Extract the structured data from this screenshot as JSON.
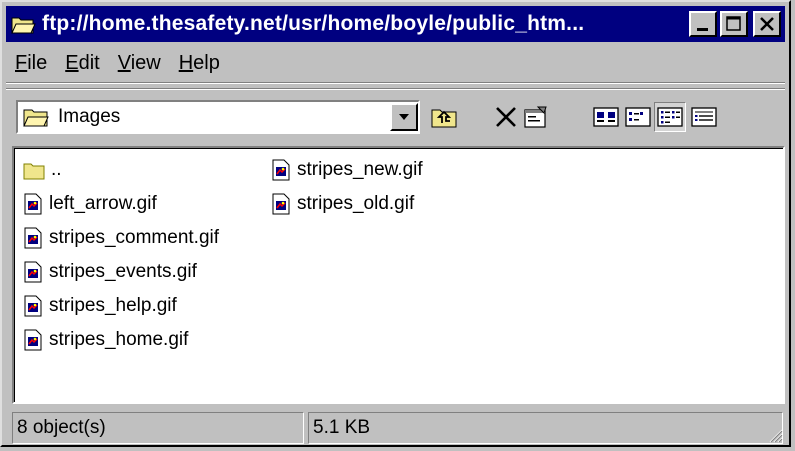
{
  "window": {
    "title": "ftp://home.thesafety.net/usr/home/boyle/public_htm...",
    "icon": "folder-open-icon",
    "controls": [
      "minimize-icon",
      "maximize-icon",
      "close-icon"
    ]
  },
  "menu": {
    "file": {
      "accel": "F",
      "rest": "ile"
    },
    "edit": {
      "accel": "E",
      "rest": "dit"
    },
    "view": {
      "accel": "V",
      "rest": "iew"
    },
    "help": {
      "accel": "H",
      "rest": "elp"
    }
  },
  "toolbar": {
    "address": {
      "value": "Images",
      "icon": "folder-open-icon"
    },
    "buttons": [
      "up-one-level-icon",
      "delete-icon",
      "properties-icon",
      "large-icons-view-icon",
      "small-icons-view-icon",
      "list-view-icon",
      "details-view-icon"
    ],
    "active_view": "list"
  },
  "files": [
    {
      "name": "..",
      "icon": "folder-icon"
    },
    {
      "name": "left_arrow.gif",
      "icon": "gif-file-icon"
    },
    {
      "name": "stripes_comment.gif",
      "icon": "gif-file-icon"
    },
    {
      "name": "stripes_events.gif",
      "icon": "gif-file-icon"
    },
    {
      "name": "stripes_help.gif",
      "icon": "gif-file-icon"
    },
    {
      "name": "stripes_home.gif",
      "icon": "gif-file-icon"
    },
    {
      "name": "stripes_new.gif",
      "icon": "gif-file-icon"
    },
    {
      "name": "stripes_old.gif",
      "icon": "gif-file-icon"
    }
  ],
  "status": {
    "objects": "8 object(s)",
    "size": "5.1 KB"
  },
  "colors": {
    "titlebar": "#000080",
    "face": "#c0c0c0",
    "folder": "#f0e68c"
  }
}
